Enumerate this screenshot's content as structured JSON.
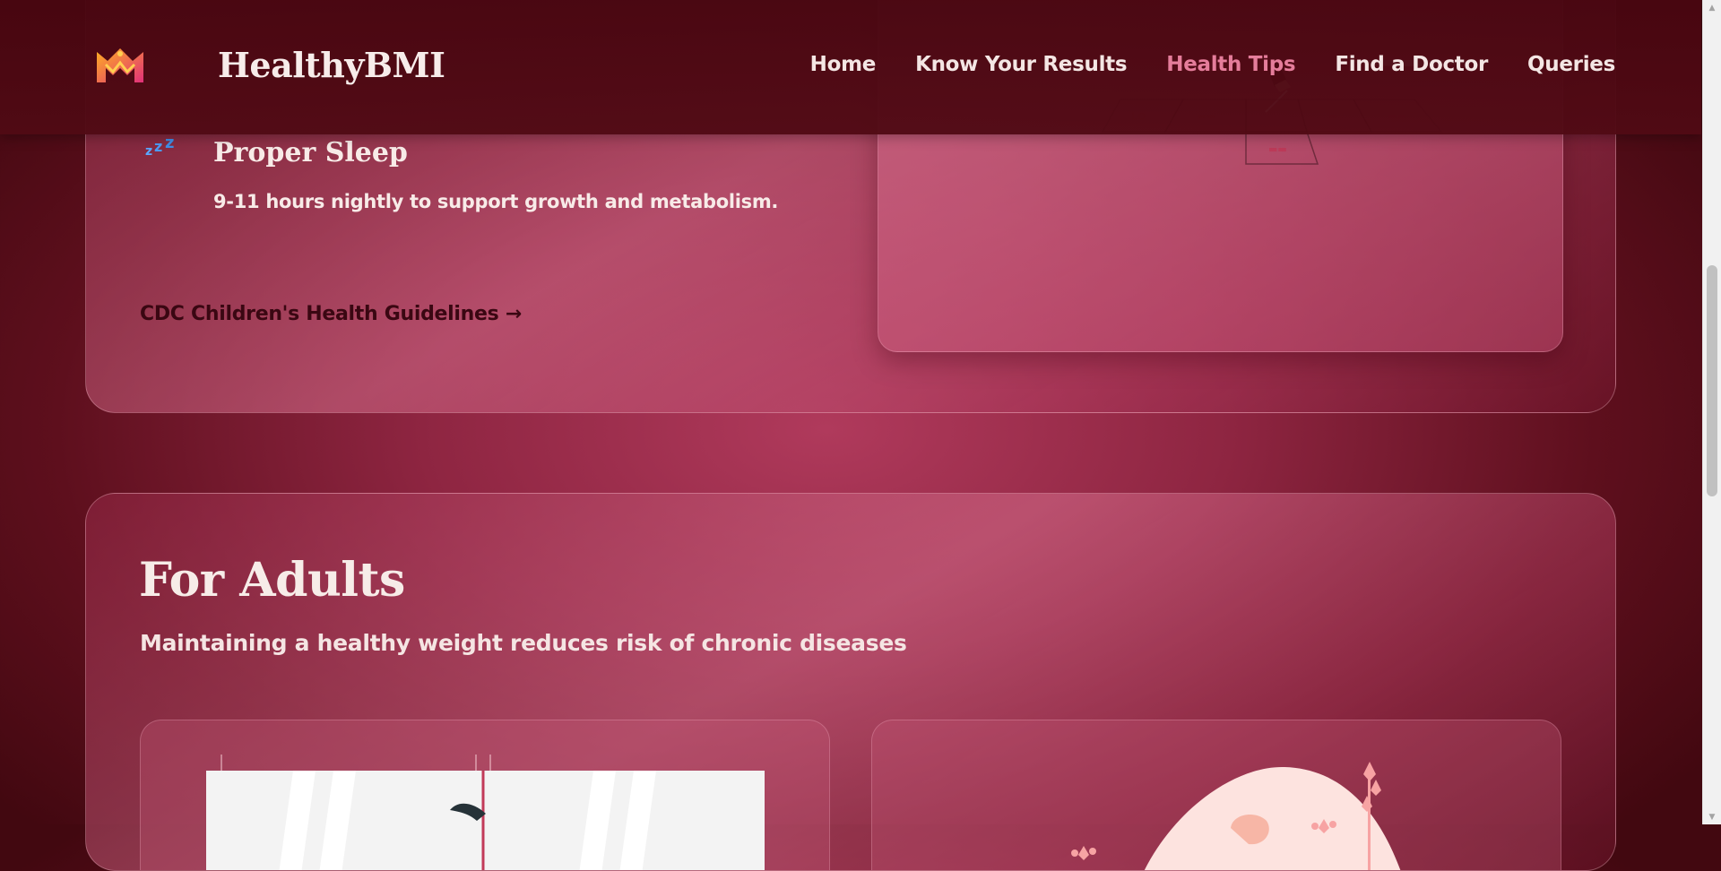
{
  "header": {
    "brand": "HealthyBMI",
    "nav": [
      {
        "label": "Home",
        "active": false
      },
      {
        "label": "Know Your Results",
        "active": false
      },
      {
        "label": "Health Tips",
        "active": true
      },
      {
        "label": "Find a Doctor",
        "active": false
      },
      {
        "label": "Queries",
        "active": false
      }
    ]
  },
  "children_section": {
    "tip": {
      "icon": "sleep-zzz-icon",
      "title": "Proper Sleep",
      "description": "9-11 hours nightly to support growth and metabolism."
    },
    "guidelines_link": "CDC Children's Health Guidelines →"
  },
  "adults_section": {
    "title": "For Adults",
    "subtitle": "Maintaining a healthy weight reduces risk of chronic diseases"
  },
  "colors": {
    "accent_active_nav": "#e57d9b",
    "header_bg": "#4a0610",
    "page_bg": "#8e2541",
    "link_dark": "#3a0712"
  }
}
